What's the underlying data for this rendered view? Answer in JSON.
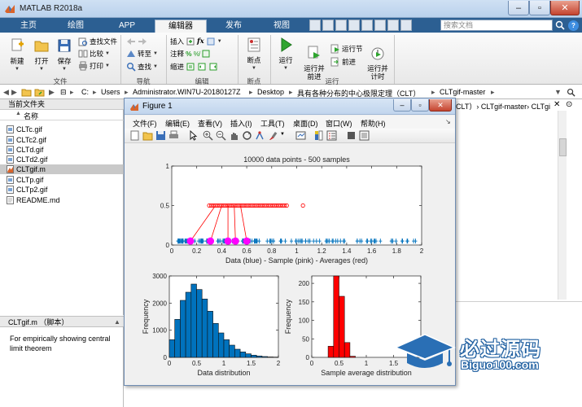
{
  "app": {
    "title": "MATLAB R2018a"
  },
  "tabs": [
    "主页",
    "绘图",
    "APP",
    "编辑器",
    "发布",
    "视图"
  ],
  "active_tab": "编辑器",
  "search": {
    "placeholder": "搜索文档"
  },
  "ribbon": {
    "file": {
      "new": "新建",
      "open": "打开",
      "save": "保存",
      "find_files": "查找文件",
      "compare": "比较",
      "print": "打印",
      "group": "文件"
    },
    "navigate": {
      "goto": "转至",
      "find": "查找",
      "group": "导航"
    },
    "edit": {
      "insert": "插入",
      "fx": "fx",
      "comment": "注释",
      "indent": "缩进",
      "group": "编辑"
    },
    "breakpoints": {
      "breakpoints": "断点",
      "group": "断点"
    },
    "run": {
      "run": "运行",
      "run_advance": "运行并\n前进",
      "run_section": "运行节",
      "advance": "前进",
      "run_time": "运行并\n计时",
      "group": "运行"
    }
  },
  "address": {
    "segments": [
      "C:",
      "Users",
      "Administrator.WIN7U-20180127Z",
      "Desktop",
      "具有各种分布的中心极限定理（CLT）",
      "CLTgif-master"
    ]
  },
  "current_folder": {
    "title": "当前文件夹",
    "column": "名称",
    "files": [
      "CLTc.gif",
      "CLTc2.gif",
      "CLTd.gif",
      "CLTd2.gif",
      "CLTgif.m",
      "CLTp.gif",
      "CLTp2.gif",
      "README.md"
    ],
    "selected": "CLTgif.m"
  },
  "details": {
    "title": "CLTgif.m （脚本）",
    "text": "For empirically showing central limit theorem"
  },
  "right_panel": {
    "path": "CLT）› CLTgif-master› CLTgi"
  },
  "figure": {
    "title": "Figure 1",
    "menus": [
      "文件(F)",
      "编辑(E)",
      "查看(V)",
      "插入(I)",
      "工具(T)",
      "桌面(D)",
      "窗口(W)",
      "帮助(H)"
    ]
  },
  "colors": {
    "ribbon_tab_bar": "#2c5f92",
    "blue_data": "#0072bd",
    "red_sample": "#ff0000",
    "magenta_average": "#ff00ff"
  },
  "chart_data": [
    {
      "type": "scatter",
      "title": "10000 data points - 500 samples",
      "xlabel": "Data (blue) - Sample (pink) - Averages (red)",
      "ylabel": "",
      "xlim": [
        0,
        2
      ],
      "ylim": [
        0,
        1
      ],
      "xticks": [
        "0",
        "0.2",
        "0.4",
        "0.6",
        "0.8",
        "1",
        "1.2",
        "1.4",
        "1.6",
        "1.8",
        "2"
      ],
      "yticks": [
        "0",
        "0.5",
        "1"
      ],
      "series": [
        {
          "color": "#0072bd",
          "y": 0.05,
          "x_from": 0.05,
          "x_to": 1.98
        },
        {
          "color": "#ff0000",
          "y": 0.5,
          "x_from": 0.3,
          "x_to": 1.05,
          "outlier": 1.05
        },
        {
          "color": "#ff00ff",
          "y": 0.05,
          "x": [
            0.15,
            0.31,
            0.45,
            0.51,
            0.6
          ]
        }
      ]
    },
    {
      "type": "bar",
      "xlabel": "Data distribution",
      "ylabel": "Frequency",
      "xlim": [
        0,
        2
      ],
      "ylim": [
        0,
        3000
      ],
      "xticks": [
        "0",
        "0.5",
        "1",
        "1.5",
        "2"
      ],
      "yticks": [
        "0",
        "1000",
        "2000",
        "3000"
      ],
      "bin_width": 0.1,
      "bins_start": [
        0.0,
        0.1,
        0.2,
        0.3,
        0.4,
        0.5,
        0.6,
        0.7,
        0.8,
        0.9,
        1.0,
        1.1,
        1.2,
        1.3,
        1.4,
        1.5,
        1.6,
        1.7,
        1.8,
        1.9
      ],
      "values": [
        650,
        1400,
        2100,
        2400,
        2700,
        2500,
        2150,
        1700,
        1250,
        900,
        650,
        450,
        300,
        200,
        130,
        80,
        50,
        30,
        15,
        10
      ]
    },
    {
      "type": "bar",
      "xlabel": "Sample average distribution",
      "ylabel": "Frequency",
      "xlim": [
        0,
        2
      ],
      "ylim": [
        0,
        220
      ],
      "xticks": [
        "0",
        "0.5",
        "1",
        "1.5",
        "2"
      ],
      "yticks": [
        "0",
        "50",
        "100",
        "150",
        "200"
      ],
      "bin_width": 0.1,
      "bins_start": [
        0.3,
        0.4,
        0.5,
        0.6,
        0.7
      ],
      "values": [
        30,
        240,
        165,
        40,
        3
      ]
    }
  ],
  "watermark": {
    "text": "必过源码",
    "url": "Biguo100.com"
  }
}
